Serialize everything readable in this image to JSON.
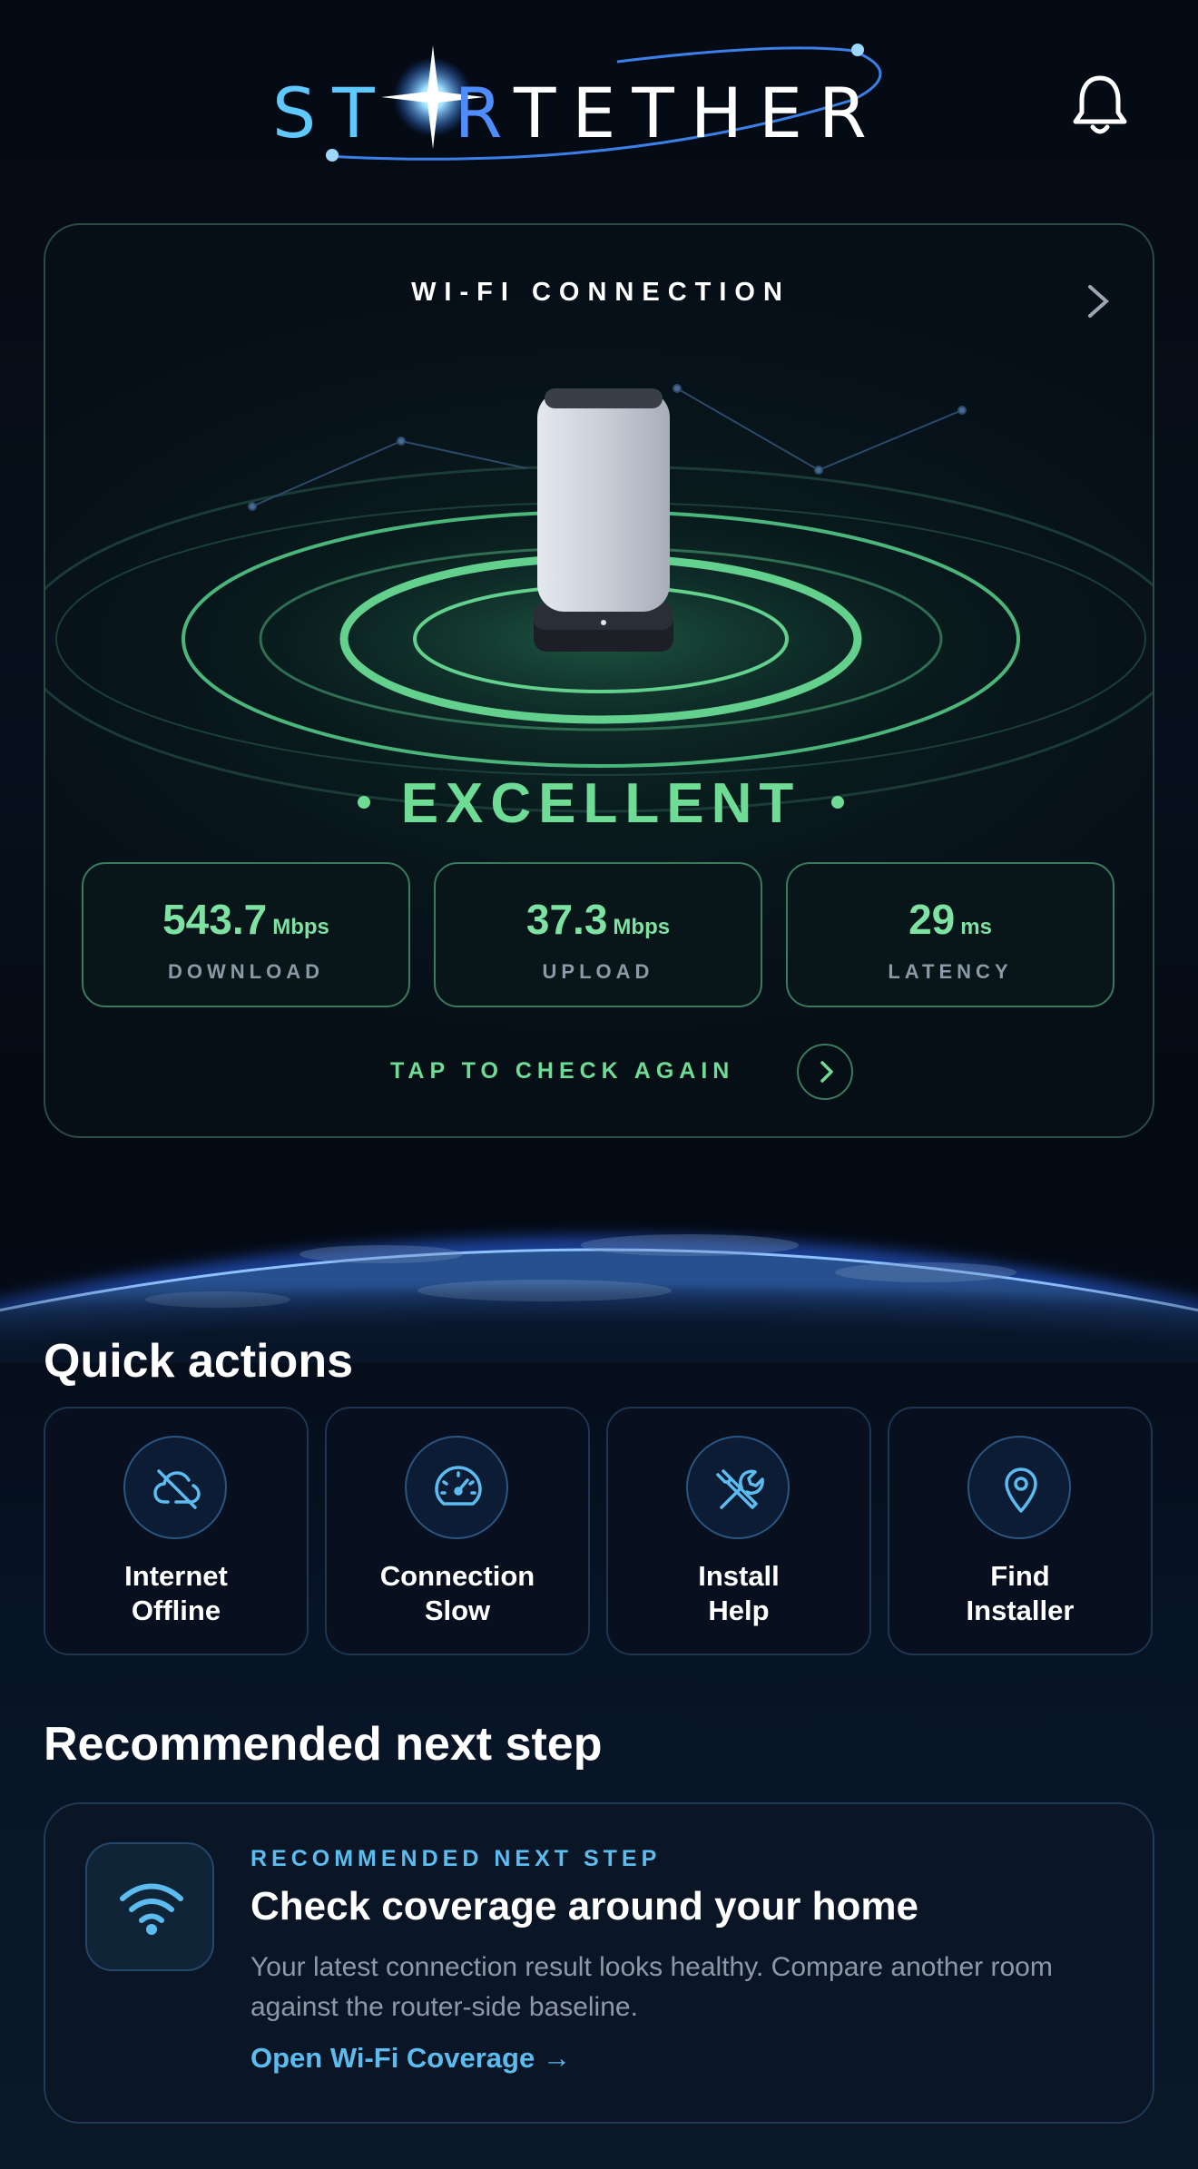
{
  "app": {
    "logo": "STARTETHER",
    "logo_parts": {
      "st": "ST",
      "r": "R",
      "tether": "TETHER"
    },
    "notifications_icon": "bell-icon"
  },
  "wifi": {
    "title": "WI-FI CONNECTION",
    "quality": "EXCELLENT",
    "stats": [
      {
        "value": "543.7",
        "unit": "Mbps",
        "label": "DOWNLOAD"
      },
      {
        "value": "37.3",
        "unit": "Mbps",
        "label": "UPLOAD"
      },
      {
        "value": "29",
        "unit": "ms",
        "label": "LATENCY"
      }
    ],
    "recheck_label": "TAP TO CHECK AGAIN",
    "accent": "#6fdc96"
  },
  "quick_actions": {
    "title": "Quick actions",
    "items": [
      {
        "line1": "Internet",
        "line2": "Offline",
        "icon": "cloud-off-icon"
      },
      {
        "line1": "Connection",
        "line2": "Slow",
        "icon": "speedometer-icon"
      },
      {
        "line1": "Install",
        "line2": "Help",
        "icon": "tools-icon"
      },
      {
        "line1": "Find",
        "line2": "Installer",
        "icon": "map-pin-icon"
      }
    ]
  },
  "recommended": {
    "section_title": "Recommended next step",
    "kicker": "RECOMMENDED NEXT STEP",
    "title": "Check coverage around your home",
    "description": "Your latest connection result looks healthy. Compare another room against the router-side baseline.",
    "link": "Open Wi-Fi Coverage →",
    "icon": "wifi-icon",
    "accent": "#5cbcf0"
  }
}
